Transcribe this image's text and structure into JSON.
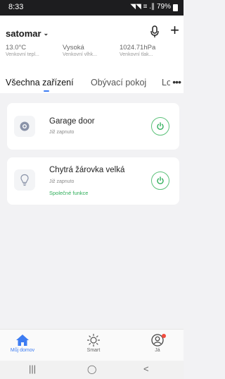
{
  "status_bar": {
    "time": "8:33",
    "signal": "◥◥ ≡ .∥",
    "battery": "79%"
  },
  "header": {
    "home_name": "satomar",
    "chevron": "⌄"
  },
  "weather": [
    {
      "value": "13.0°C",
      "label": "Venkovní tepl..."
    },
    {
      "value": "Vysoká",
      "label": "Venkovní vlhk..."
    },
    {
      "value": "1024.71hPa",
      "label": "Venkovní tlak..."
    }
  ],
  "tabs": [
    {
      "label": "Všechna zařízení",
      "active": true
    },
    {
      "label": "Obývací pokoj"
    },
    {
      "label": "Lož"
    }
  ],
  "more": "•••",
  "devices": [
    {
      "name": "Garage door",
      "status": "Již zapnuto",
      "extra": "",
      "icon": "garage-door-icon"
    },
    {
      "name": "Chytrá žárovka velká",
      "status": "Již zapnuto",
      "extra": "Společné funkce",
      "icon": "light-bulb-icon"
    }
  ],
  "bottom_tabs": [
    {
      "label": "Můj domov",
      "active": true
    },
    {
      "label": "Smart"
    },
    {
      "label": "Já"
    }
  ],
  "nav": {
    "recents": "|||",
    "home": "◯",
    "back": "<"
  },
  "colors": {
    "accent": "#3d7cf2",
    "on_green": "#2fae5a",
    "background": "#f2f2f4"
  }
}
